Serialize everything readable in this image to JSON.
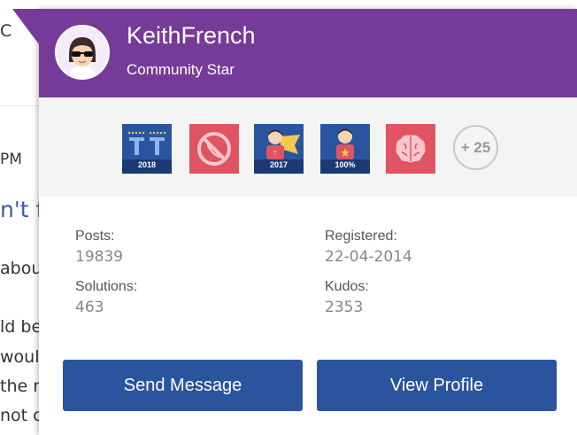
{
  "background": {
    "lines": [
      "C",
      "PM",
      "n't f",
      "abou",
      "ld be",
      "woul",
      "the r",
      "not c"
    ]
  },
  "profile": {
    "username": "KeithFrench",
    "rank": "Community Star",
    "avatar_icon": "avatar-sunglasses-icon"
  },
  "badges": {
    "items": [
      {
        "icon": "ranking-badge-icon",
        "label": "2018",
        "color": "#2a549e"
      },
      {
        "icon": "no-phone-badge-icon",
        "label": "",
        "color": "#e05462"
      },
      {
        "icon": "superhero-badge-icon",
        "label": "2017",
        "color": "#2a549e"
      },
      {
        "icon": "hero-badge-icon",
        "label": "100%",
        "color": "#2a549e"
      },
      {
        "icon": "brain-badge-icon",
        "label": "",
        "color": "#e05462"
      }
    ],
    "more_label": "+ 25"
  },
  "stats": {
    "posts_label": "Posts:",
    "posts_value": "19839",
    "registered_label": "Registered:",
    "registered_value": "22-04-2014",
    "solutions_label": "Solutions:",
    "solutions_value": "463",
    "kudos_label": "Kudos:",
    "kudos_value": "2353"
  },
  "actions": {
    "send_message": "Send Message",
    "view_profile": "View Profile"
  },
  "colors": {
    "header": "#763a98",
    "button": "#2a549e",
    "badge_band": "#f4f4f4"
  }
}
